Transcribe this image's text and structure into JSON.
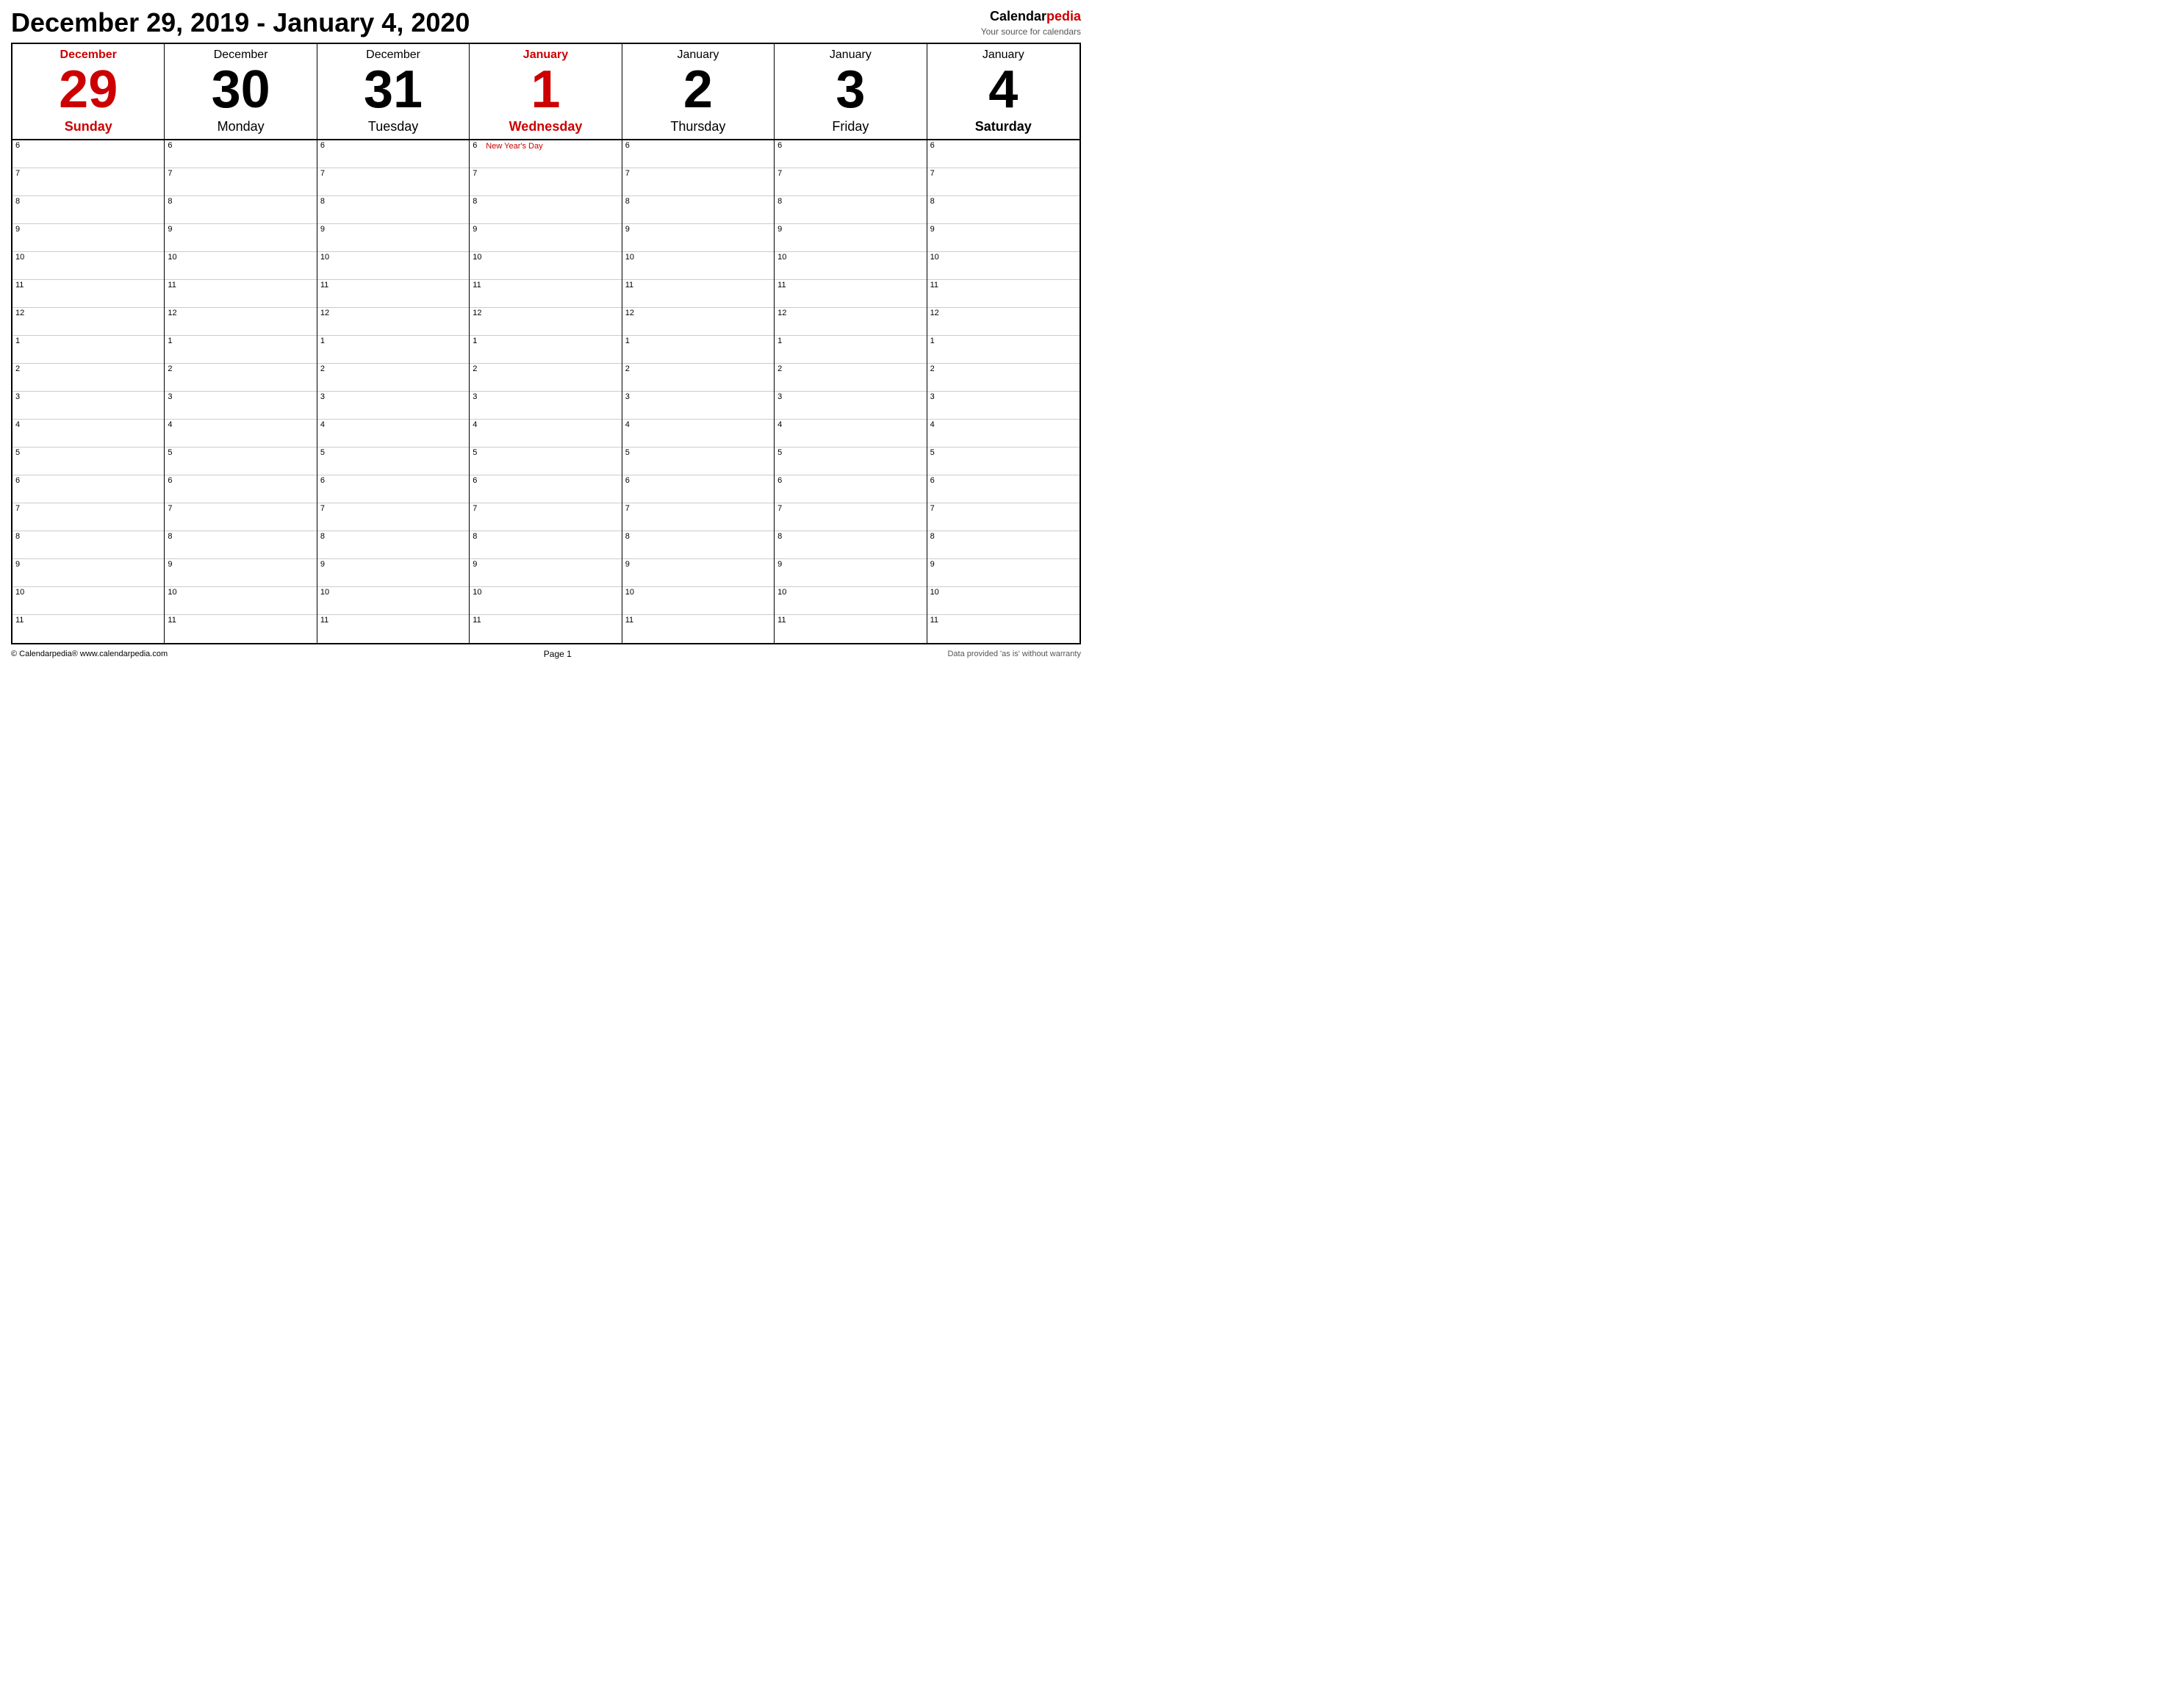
{
  "header": {
    "title": "December 29, 2019 - January 4, 2020",
    "brand_name": "Calendar",
    "brand_name_red": "pedia",
    "brand_subtitle": "Your source for calendars"
  },
  "days": [
    {
      "month": "December",
      "number": "29",
      "name": "Sunday",
      "today": false,
      "red": true
    },
    {
      "month": "December",
      "number": "30",
      "name": "Monday",
      "today": false,
      "red": false
    },
    {
      "month": "December",
      "number": "31",
      "name": "Tuesday",
      "today": false,
      "red": false
    },
    {
      "month": "January",
      "number": "1",
      "name": "Wednesday",
      "today": true,
      "red": true
    },
    {
      "month": "January",
      "number": "2",
      "name": "Thursday",
      "today": false,
      "red": false
    },
    {
      "month": "January",
      "number": "3",
      "name": "Friday",
      "today": false,
      "red": false
    },
    {
      "month": "January",
      "number": "4",
      "name": "Saturday",
      "today": false,
      "red": false,
      "bold_name": true
    }
  ],
  "time_slots": [
    "6",
    "7",
    "8",
    "9",
    "10",
    "11",
    "12",
    "1",
    "2",
    "3",
    "4",
    "5",
    "6",
    "7",
    "8",
    "9",
    "10",
    "11"
  ],
  "events": {
    "jan1_6": "New Year's Day"
  },
  "footer": {
    "left": "© Calendarpedia®   www.calendarpedia.com",
    "center": "Page 1",
    "right": "Data provided 'as is' without warranty"
  }
}
